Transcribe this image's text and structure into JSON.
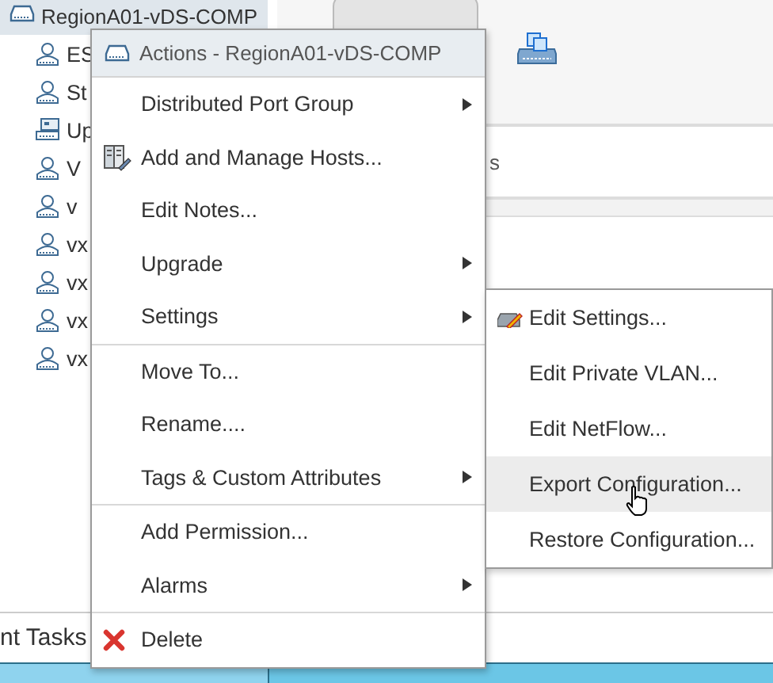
{
  "tree": {
    "root": {
      "label": "RegionA01-vDS-COMP",
      "selected": true
    },
    "children": [
      {
        "label": "ES",
        "kind": "portgroup",
        "selected": false
      },
      {
        "label": "St",
        "kind": "portgroup",
        "selected": false
      },
      {
        "label": "Up",
        "kind": "uplink",
        "selected": false
      },
      {
        "label": "V",
        "kind": "portgroup",
        "selected": false
      },
      {
        "label": "v",
        "kind": "portgroup",
        "selected": false
      },
      {
        "label": "vx",
        "kind": "portgroup",
        "selected": false
      },
      {
        "label": "vx",
        "kind": "portgroup",
        "selected": false
      },
      {
        "label": "vx",
        "kind": "portgroup",
        "selected": false
      },
      {
        "label": "vx",
        "kind": "portgroup",
        "selected": false
      }
    ]
  },
  "detail_tab_fragment": "s",
  "bottom_tab": {
    "label": "nt Tasks"
  },
  "context_menu": {
    "title": "Actions - RegionA01-vDS-COMP",
    "groups": [
      [
        {
          "label": "Distributed Port Group",
          "submenu": true
        },
        {
          "label": "Add and Manage Hosts...",
          "submenu": false,
          "kind": "hosts"
        },
        {
          "label": "Edit Notes...",
          "submenu": false
        },
        {
          "label": "Upgrade",
          "submenu": true
        },
        {
          "label": "Settings",
          "submenu": true
        }
      ],
      [
        {
          "label": "Move To...",
          "submenu": false
        },
        {
          "label": "Rename....",
          "submenu": false
        },
        {
          "label": "Tags & Custom Attributes",
          "submenu": true
        }
      ],
      [
        {
          "label": "Add Permission...",
          "submenu": false
        },
        {
          "label": "Alarms",
          "submenu": true
        }
      ],
      [
        {
          "label": "Delete",
          "submenu": false,
          "kind": "delete"
        }
      ]
    ]
  },
  "settings_submenu": {
    "items": [
      {
        "label": "Edit Settings...",
        "kind": "edit",
        "selected": false
      },
      {
        "label": "Edit Private VLAN...",
        "selected": false
      },
      {
        "label": "Edit NetFlow...",
        "selected": false
      },
      {
        "label": "Export Configuration...",
        "selected": true
      },
      {
        "label": "Restore Configuration...",
        "selected": false
      }
    ]
  }
}
